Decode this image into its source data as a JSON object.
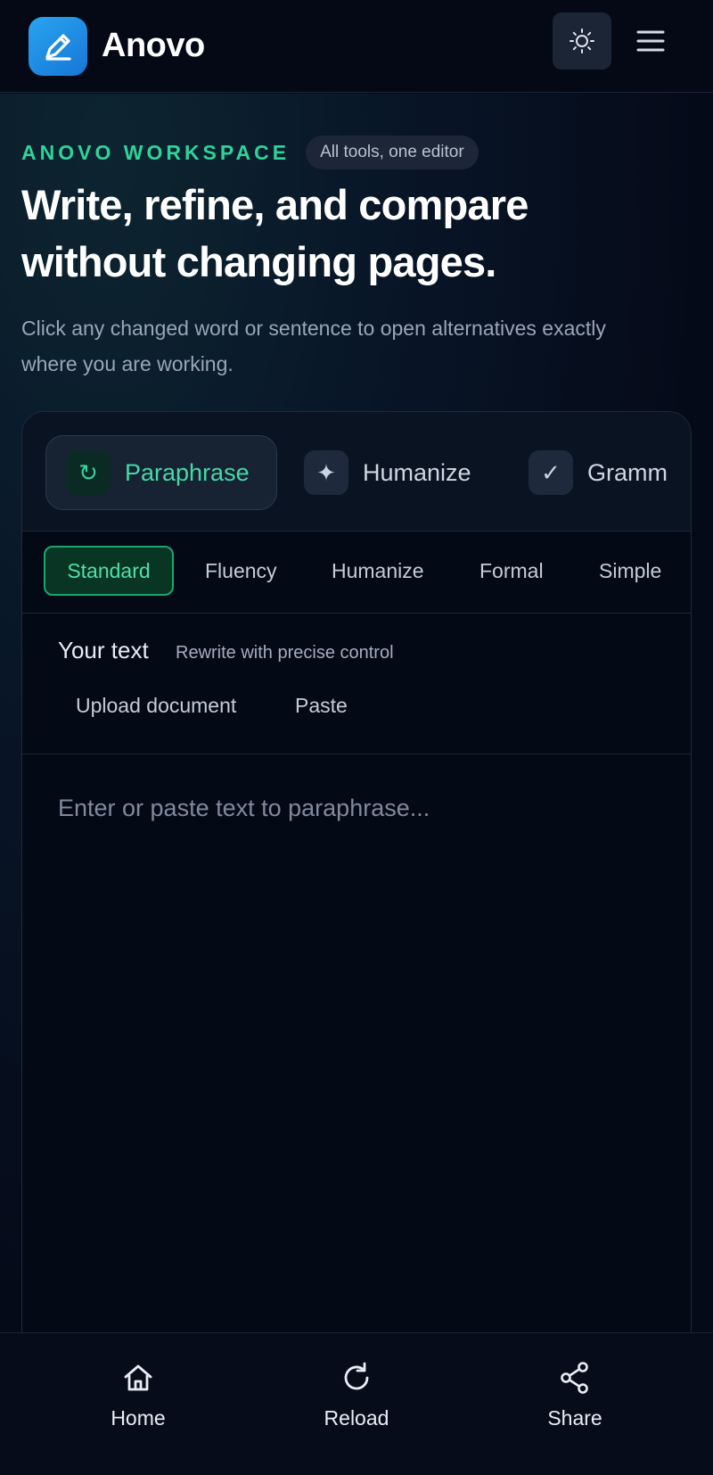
{
  "header": {
    "brand": "Anovo",
    "logo_icon": "pencil-icon",
    "theme_toggle_icon": "sun-icon",
    "menu_icon": "hamburger-menu-icon"
  },
  "hero": {
    "eyebrow": "ANOVO WORKSPACE",
    "pill": "All tools, one editor",
    "headline": "Write, refine, and compare without changing pages.",
    "subtext": "Click any changed word or sentence to open alternatives exactly where you are working."
  },
  "tools": [
    {
      "label": "Paraphrase",
      "icon": "↻",
      "active": true
    },
    {
      "label": "Humanize",
      "icon": "✦",
      "active": false
    },
    {
      "label": "Gramm",
      "icon": "✓",
      "active": false
    }
  ],
  "modes": [
    {
      "label": "Standard",
      "active": true
    },
    {
      "label": "Fluency",
      "active": false
    },
    {
      "label": "Humanize",
      "active": false
    },
    {
      "label": "Formal",
      "active": false
    },
    {
      "label": "Simple",
      "active": false
    }
  ],
  "editor": {
    "title": "Your text",
    "hint": "Rewrite with precise control",
    "upload_label": "Upload document",
    "paste_label": "Paste",
    "placeholder": "Enter or paste text to paraphrase...",
    "value": ""
  },
  "bottom_nav": [
    {
      "label": "Home",
      "icon": "home-icon"
    },
    {
      "label": "Reload",
      "icon": "reload-icon"
    },
    {
      "label": "Share",
      "icon": "share-icon"
    }
  ],
  "colors": {
    "accent_green": "#34d399",
    "background": "#050a18",
    "logo_blue": "#1f8fe6"
  }
}
